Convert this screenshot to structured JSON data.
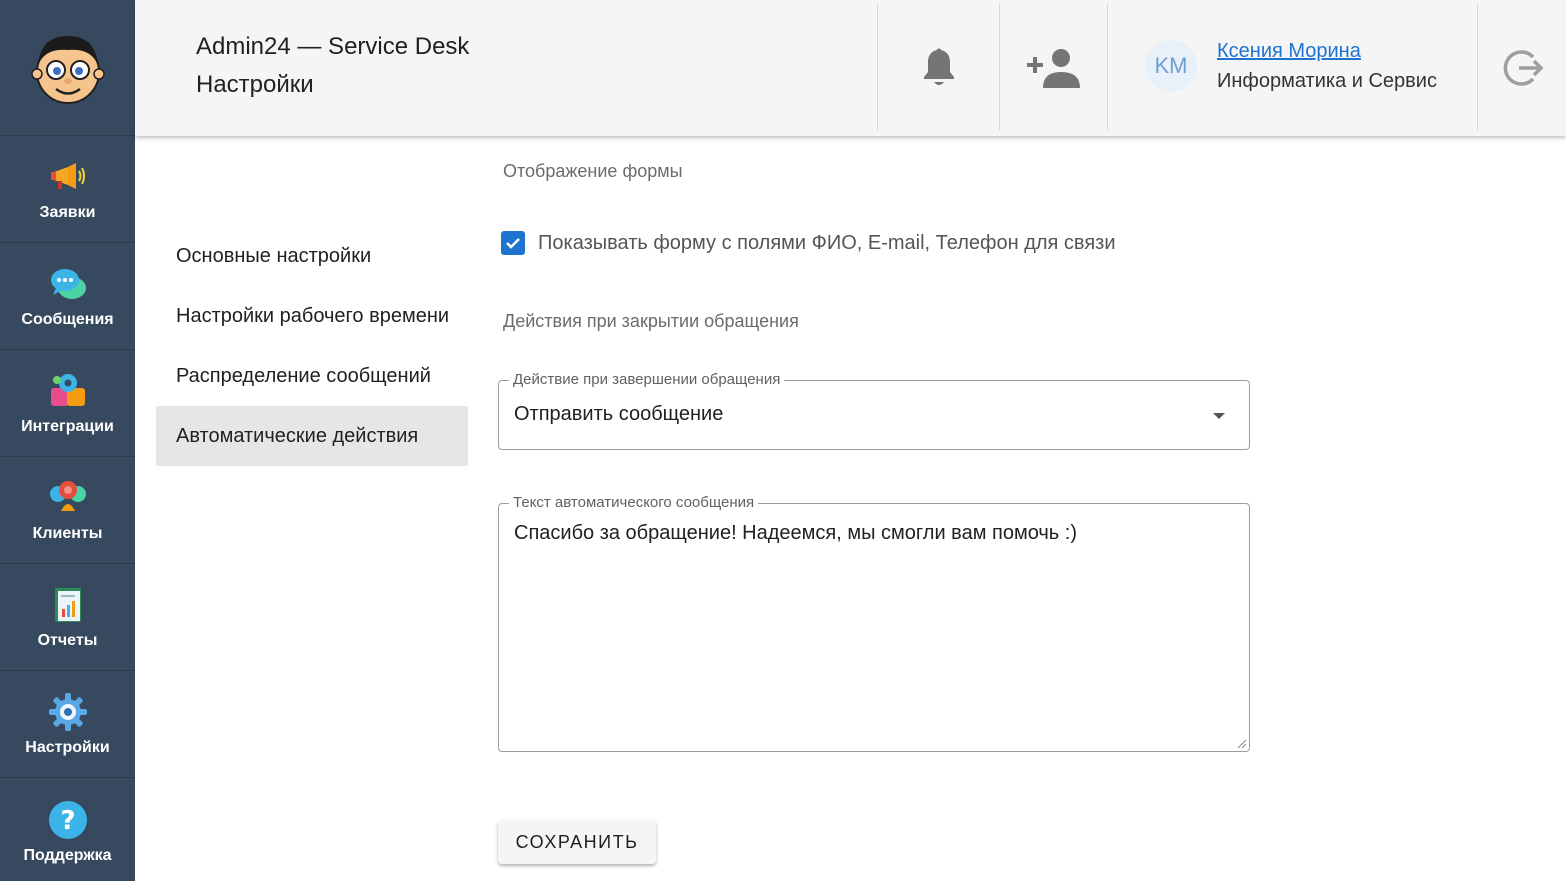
{
  "header": {
    "app_title": "Admin24 — Service Desk",
    "page_title": "Настройки",
    "user": {
      "initials": "KM",
      "name": "Ксения Морина",
      "org": "Информатика и Сервис"
    }
  },
  "sidebar": {
    "items": [
      {
        "label": "Заявки",
        "icon": "megaphone-icon"
      },
      {
        "label": "Сообщения",
        "icon": "chat-bubbles-icon"
      },
      {
        "label": "Интеграции",
        "icon": "puzzle-gear-icon"
      },
      {
        "label": "Клиенты",
        "icon": "people-icon"
      },
      {
        "label": "Отчеты",
        "icon": "report-icon"
      },
      {
        "label": "Настройки",
        "icon": "gear-icon"
      },
      {
        "label": "Поддержка",
        "icon": "help-icon"
      }
    ]
  },
  "settings_menu": {
    "items": [
      {
        "label": "Основные настройки"
      },
      {
        "label": "Настройки рабочего времени"
      },
      {
        "label": "Распределение сообщений"
      },
      {
        "label": "Автоматические действия"
      }
    ],
    "active": "Автоматические действия"
  },
  "content": {
    "form_display_title": "Отображение формы",
    "show_form_checkbox": {
      "label": "Показывать форму с полями ФИО, E-mail, Телефон для связи",
      "checked": true
    },
    "close_actions_title": "Действия при закрытии обращения",
    "close_action_select": {
      "legend": "Действие при завершении обращения",
      "value": "Отправить сообщение"
    },
    "auto_message": {
      "legend": "Текст автоматического сообщения",
      "value": "Спасибо за обращение! Надеемся, мы смогли вам помочь :)"
    },
    "save_label": "СОХРАНИТЬ"
  },
  "colors": {
    "sidebar": "#36495e",
    "accent": "#1e73d0",
    "header_bg": "#f5f5f5",
    "active_menu": "#e6e6e6"
  }
}
